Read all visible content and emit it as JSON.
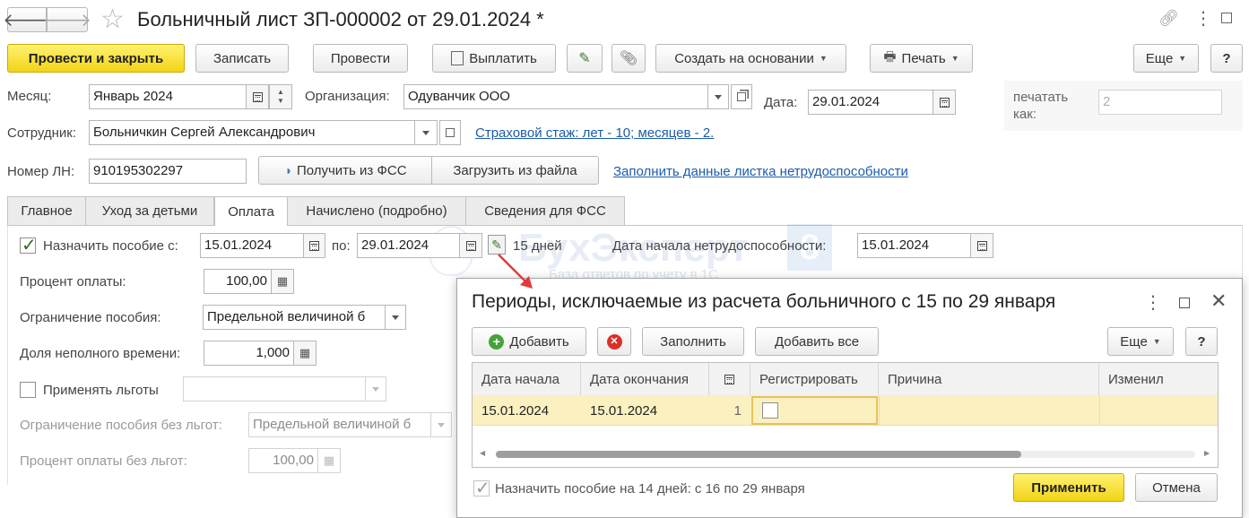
{
  "window": {
    "title": "Больничный лист ЗП-000002 от 29.01.2024 *"
  },
  "toolbar": {
    "post_close": "Провести и закрыть",
    "save": "Записать",
    "post": "Провести",
    "pay": "Выплатить",
    "create_based": "Создать на основании",
    "print": "Печать",
    "more": "Еще",
    "help": "?"
  },
  "form": {
    "month_label": "Месяц:",
    "month_value": "Январь 2024",
    "org_label": "Организация:",
    "org_value": "Одуванчик ООО",
    "date_label": "Дата:",
    "date_value": "29.01.2024",
    "print_as_label_1": "печатать",
    "print_as_label_2": "как:",
    "print_as_value": "2",
    "employee_label": "Сотрудник:",
    "employee_value": "Больничкин Сергей Александрович",
    "insurance_link": "Страховой стаж: лет - 10; месяцев - 2.",
    "ln_label": "Номер ЛН:",
    "ln_value": "910195302297",
    "get_fss": "Получить из ФСС",
    "load_file": "Загрузить из файла",
    "fill_link": "Заполнить данные листка нетрудоспособности"
  },
  "tabs": [
    {
      "label": "Главное"
    },
    {
      "label": "Уход за детьми"
    },
    {
      "label": "Оплата"
    },
    {
      "label": "Начислено (подробно)"
    },
    {
      "label": "Сведения для ФСС"
    }
  ],
  "payment": {
    "assign_label": "Назначить пособие с:",
    "assign_from": "15.01.2024",
    "to_label": "по:",
    "assign_to": "29.01.2024",
    "days": "15 дней",
    "start_label": "Дата начала нетрудоспособности:",
    "start_value": "15.01.2024",
    "percent_label": "Процент оплаты:",
    "percent_value": "100,00",
    "limit_label": "Ограничение пособия:",
    "limit_value": "Предельной величиной б",
    "part_time_label": "Доля неполного времени:",
    "part_time_value": "1,000",
    "benefits_label": "Применять льготы",
    "benefits_value": "",
    "limit_no_benefits_label": "Ограничение пособия без льгот:",
    "limit_no_benefits_value": "Предельной величиной б",
    "percent_no_benefits_label": "Процент оплаты без льгот:",
    "percent_no_benefits_value": "100,00"
  },
  "watermark": {
    "text": "БухЭксперт",
    "num": "8",
    "sub": "База ответов по учету в 1С"
  },
  "dialog": {
    "title": "Периоды, исключаемые из расчета больничного с 15 по 29 января",
    "add": "Добавить",
    "fill": "Заполнить",
    "add_all": "Добавить все",
    "more": "Еще",
    "help": "?",
    "columns": [
      "Дата начала",
      "Дата окончания",
      "Регистрировать",
      "Причина",
      "Изменил"
    ],
    "rows": [
      {
        "start": "15.01.2024",
        "end": "15.01.2024",
        "days": "1",
        "register": "",
        "reason": "",
        "changed": ""
      }
    ],
    "footer_label": "Назначить пособие на 14 дней: с 16 по 29 января",
    "apply": "Применить",
    "cancel": "Отмена"
  },
  "colors": {
    "primary_button": "#f3d417",
    "link": "#1c5cab",
    "selected_row": "#fbf0c0",
    "arrow": "#e03b3b"
  }
}
